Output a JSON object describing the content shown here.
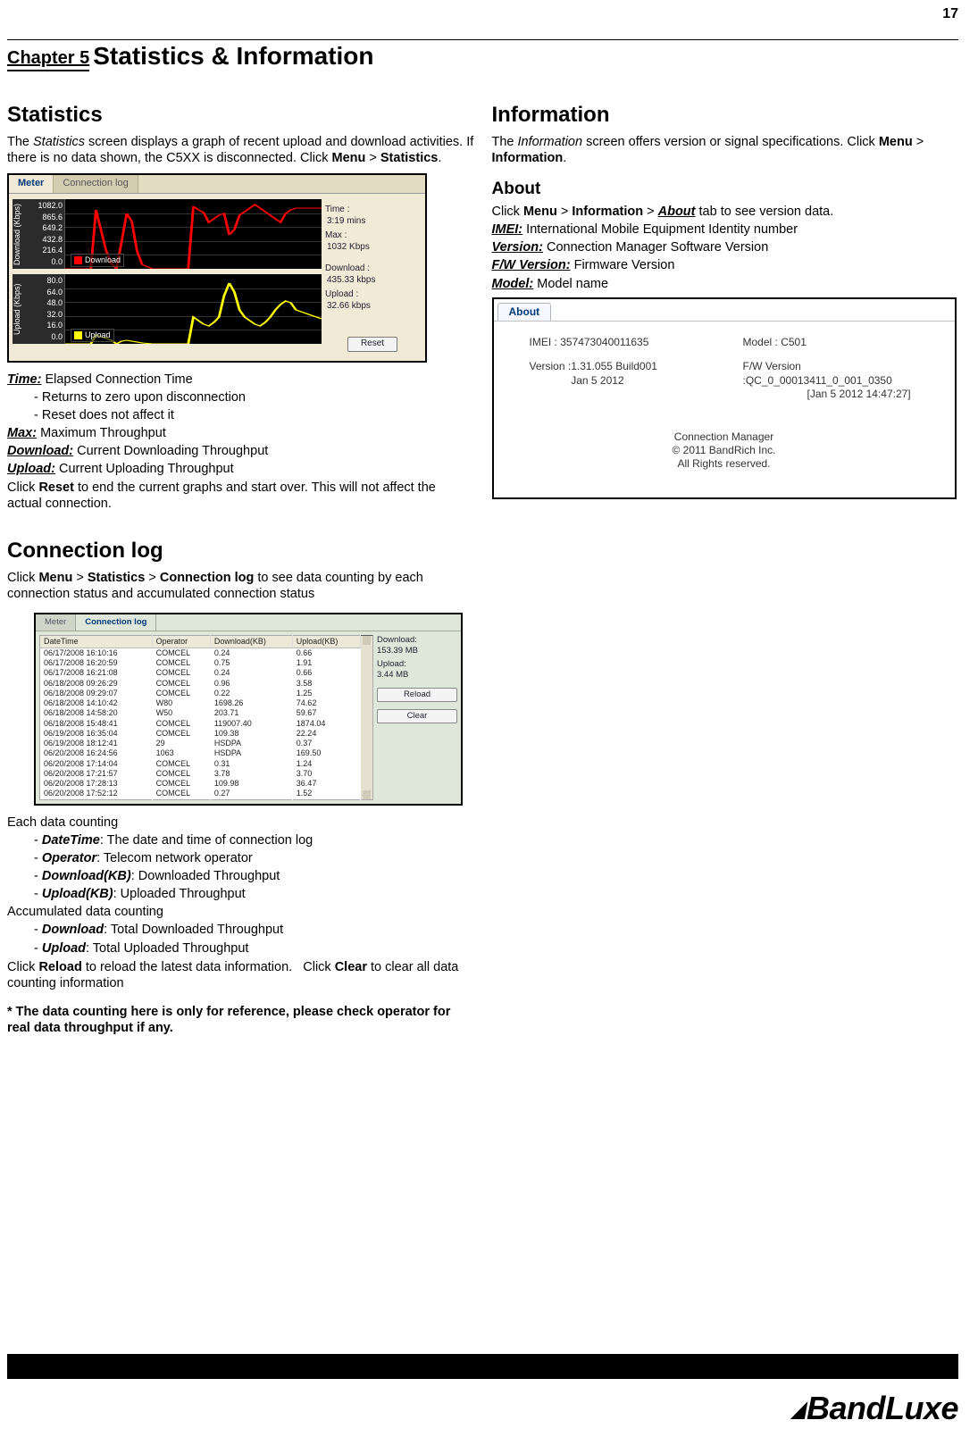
{
  "page_number": "17",
  "chapter_label": "Chapter 5",
  "chapter_title": "Statistics & Information",
  "left": {
    "statistics_heading": "Statistics",
    "statistics_intro_pre": "The ",
    "statistics_intro_ital": "Statistics",
    "statistics_intro_post": " screen displays a graph of recent upload and download activities. If there is no data shown, the C5XX is disconnected. Click ",
    "menu_path_menu": "Menu",
    "menu_path_gt": " > ",
    "menu_path_stats": "Statistics",
    "period": ".",
    "meter": {
      "tab_meter": "Meter",
      "tab_log": "Connection log",
      "axis_download": "Download (Kbps)",
      "axis_upload": "Upload (Kbps)",
      "download_ticks": [
        "1082.0",
        "865.6",
        "649.2",
        "432.8",
        "216.4",
        "0.0"
      ],
      "upload_ticks": [
        "80.0",
        "64.0",
        "48.0",
        "32.0",
        "16.0",
        "0.0"
      ],
      "legend_download": "Download",
      "legend_upload": "Upload",
      "side_time_lbl": "Time :",
      "side_time_val": "3:19 mins",
      "side_max_lbl": "Max :",
      "side_max_val": "1032 Kbps",
      "side_dl_lbl": "Download :",
      "side_dl_val": "435.33 kbps",
      "side_ul_lbl": "Upload :",
      "side_ul_val": "32.66 kbps",
      "reset_label": "Reset"
    },
    "defs": {
      "time_lbl": "Time:",
      "time_desc": " Elapsed Connection Time",
      "time_b1": "- Returns to zero upon disconnection",
      "time_b2": "- Reset does not affect it",
      "max_lbl": "Max:",
      "max_desc": " Maximum Throughput",
      "dl_lbl": "Download:",
      "dl_desc": " Current Downloading Throughput",
      "ul_lbl": "Upload:",
      "ul_desc": " Current Uploading Throughput",
      "reset_sentence_pre": "Click ",
      "reset_bold": "Reset",
      "reset_sentence_post": " to end the current graphs and start over. This will not affect the actual connection."
    },
    "connlog_heading": "Connection log",
    "connlog_intro_pre": "Click ",
    "connlog_path_1": "Menu",
    "connlog_path_2": "Statistics",
    "connlog_path_3": "Connection log",
    "connlog_intro_post": " to see data counting by each connection status and accumulated connection status",
    "log": {
      "tab_meter": "Meter",
      "tab_log": "Connection log",
      "cols": {
        "c0": "DateTime",
        "c1": "Operator",
        "c2": "Download(KB)",
        "c3": "Upload(KB)"
      },
      "rows": [
        [
          "06/17/2008 16:10:16",
          "COMCEL",
          "0.24",
          "0.66"
        ],
        [
          "06/17/2008 16:20:59",
          "COMCEL",
          "0.75",
          "1.91"
        ],
        [
          "06/17/2008 16:21:08",
          "COMCEL",
          "0.24",
          "0.66"
        ],
        [
          "06/18/2008 09:26:29",
          "COMCEL",
          "0.96",
          "3.58"
        ],
        [
          "06/18/2008 09:29:07",
          "COMCEL",
          "0.22",
          "1.25"
        ],
        [
          "06/18/2008 14:10:42",
          "W80",
          "1698.26",
          "74.62"
        ],
        [
          "06/18/2008 14:58:20",
          "W50",
          "203.71",
          "59.67"
        ],
        [
          "06/18/2008 15:48:41",
          "COMCEL",
          "119007.40",
          "1874.04"
        ],
        [
          "06/19/2008 16:35:04",
          "COMCEL",
          "109.38",
          "22.24"
        ],
        [
          "06/19/2008 18:12:41",
          "29",
          "HSDPA",
          "0.37"
        ],
        [
          "06/20/2008 16:24:56",
          "1063",
          "HSDPA",
          "169.50"
        ],
        [
          "06/20/2008 17:14:04",
          "COMCEL",
          "0.31",
          "1.24"
        ],
        [
          "06/20/2008 17:21:57",
          "COMCEL",
          "3.78",
          "3.70"
        ],
        [
          "06/20/2008 17:28:13",
          "COMCEL",
          "109.98",
          "36.47"
        ],
        [
          "06/20/2008 17:52:12",
          "COMCEL",
          "0.27",
          "1.52"
        ]
      ],
      "side_dl_lbl": "Download:",
      "side_dl_val": "153.39 MB",
      "side_ul_lbl": "Upload:",
      "side_ul_val": "3.44 MB",
      "reload_btn": "Reload",
      "clear_btn": "Clear"
    },
    "each_counting_heading": "Each data counting",
    "each": {
      "dt_lbl": "DateTime",
      "dt_desc": ": The date and time of connection log",
      "op_lbl": "Operator",
      "op_desc": ": Telecom network operator",
      "dlkb_lbl": "Download(KB)",
      "dlkb_desc": ": Downloaded Throughput",
      "ulkb_lbl": "Upload(KB)",
      "ulkb_desc": ": Uploaded Throughput"
    },
    "acc_counting_heading": "Accumulated data counting",
    "acc": {
      "dl_lbl": "Download",
      "dl_desc": ": Total Downloaded Throughput",
      "ul_lbl": "Upload",
      "ul_desc": ": Total Uploaded Throughput"
    },
    "reload_sentence_pre": "Click ",
    "reload_bold": "Reload",
    "reload_mid": " to reload the latest data information.   Click ",
    "clear_bold": "Clear",
    "reload_sentence_post": " to clear all data counting information",
    "footnote": "* The data counting here is only for reference, please check operator for real data throughput if any."
  },
  "right": {
    "information_heading": "Information",
    "info_intro_pre": "The ",
    "info_intro_ital": "Information",
    "info_intro_post": " screen offers version or signal specifications. Click ",
    "info_path_menu": "Menu",
    "info_path_gt": " > ",
    "info_path_info": "Information",
    "period": ".",
    "about_heading": "About",
    "about_line_pre": "Click ",
    "about_path_menu": "Menu",
    "about_path_info": "Information",
    "about_path_about": "About",
    "about_line_post": " tab to see version data.",
    "defs": {
      "imei_lbl": "IMEI:",
      "imei_desc": " International Mobile Equipment Identity number",
      "ver_lbl": "Version:",
      "ver_desc": " Connection Manager Software Version",
      "fw_lbl": "F/W Version:",
      "fw_desc": " Firmware Version",
      "model_lbl": "Model:",
      "model_desc": " Model name"
    },
    "about_panel": {
      "tab": "About",
      "imei_lbl": "IMEI :",
      "imei_val": "357473040011635",
      "model_lbl": "Model :",
      "model_val": "C501",
      "ver_lbl": "Version :",
      "ver_val_l1": "1.31.055 Build001",
      "ver_val_l2": "Jan  5 2012",
      "fw_lbl": "F/W Version :",
      "fw_val_l1": "QC_0_00013411_0_001_0350",
      "fw_val_l2": "[Jan  5 2012 14:47:27]",
      "copy_l1": "Connection Manager",
      "copy_l2": "© 2011 BandRich Inc.",
      "copy_l3": "All Rights reserved."
    }
  },
  "brand": "BandLuxe",
  "chart_data": [
    {
      "type": "line",
      "title": "Download",
      "ylabel": "Download (Kbps)",
      "ylim": [
        0,
        1082
      ],
      "y_ticks": [
        1082.0,
        865.6,
        649.2,
        432.8,
        216.4,
        0.0
      ],
      "legend": [
        "Download"
      ],
      "values_approx": [
        0,
        0,
        0,
        0,
        900,
        600,
        300,
        100,
        50,
        0,
        400,
        820,
        700,
        300,
        80,
        0,
        0,
        0,
        0,
        1000,
        900,
        850,
        700,
        760,
        800,
        820,
        500,
        600,
        800,
        850,
        900,
        950,
        900,
        850,
        800,
        760,
        700,
        820,
        860,
        900
      ]
    },
    {
      "type": "line",
      "title": "Upload",
      "ylabel": "Upload (Kbps)",
      "ylim": [
        0,
        80
      ],
      "y_ticks": [
        80.0,
        64.0,
        48.0,
        32.0,
        16.0,
        0.0
      ],
      "legend": [
        "Upload"
      ],
      "values_approx": [
        0,
        0,
        0,
        0,
        10,
        8,
        6,
        4,
        2,
        0,
        3,
        4,
        3,
        2,
        1,
        0,
        0,
        0,
        0,
        30,
        25,
        20,
        18,
        22,
        30,
        55,
        70,
        60,
        40,
        30,
        25,
        20,
        18,
        22,
        28,
        35,
        40,
        38,
        30,
        25
      ]
    }
  ]
}
